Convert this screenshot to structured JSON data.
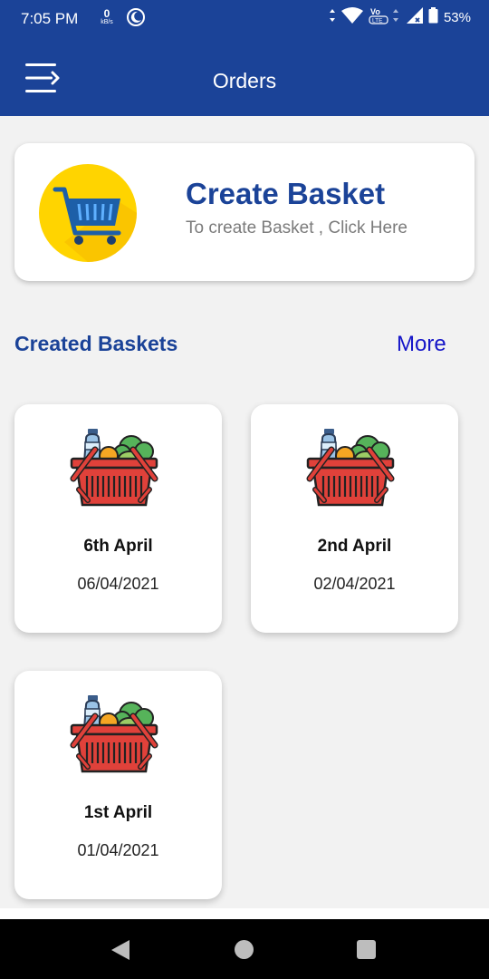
{
  "status": {
    "time": "7:05 PM",
    "net_speed": "0",
    "net_unit": "kB/s",
    "battery": "53%"
  },
  "appbar": {
    "title": "Orders"
  },
  "create_card": {
    "title": "Create Basket",
    "subtitle": "To create Basket , Click Here"
  },
  "section": {
    "title": "Created Baskets",
    "more": "More"
  },
  "baskets": [
    {
      "name": "6th April",
      "date": "06/04/2021"
    },
    {
      "name": "2nd April",
      "date": "02/04/2021"
    },
    {
      "name": "1st April",
      "date": "01/04/2021"
    }
  ],
  "colors": {
    "primary": "#1b4398",
    "link": "#1515c8",
    "basket_red": "#e0413a",
    "cart_yellow": "#ffd400"
  }
}
